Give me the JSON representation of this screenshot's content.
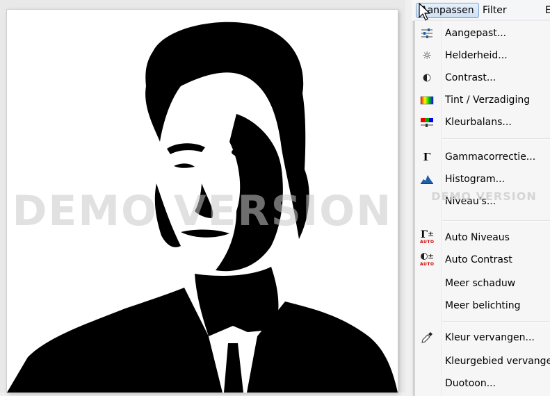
{
  "canvas": {
    "watermark": "DEMO VERSION"
  },
  "menubar": {
    "items": [
      "Aanpassen",
      "Filter",
      "E"
    ]
  },
  "menu": {
    "watermark": "DEMO VERSION",
    "items": [
      {
        "label": "Aangepast...",
        "icon": "sliders-icon"
      },
      {
        "label": "Helderheid...",
        "icon": "sun-icon"
      },
      {
        "label": "Contrast...",
        "icon": "contrast-icon"
      },
      {
        "label": "Tint / Verzadiging",
        "icon": "hue-saturation-icon"
      },
      {
        "label": "Kleurbalans...",
        "icon": "color-balance-icon"
      },
      {
        "label": "Gammacorrectie...",
        "icon": "gamma-icon"
      },
      {
        "label": "Histogram...",
        "icon": "histogram-icon"
      },
      {
        "label": "Niveau's...",
        "icon": ""
      },
      {
        "label": "Auto Niveaus",
        "icon": "auto-levels-icon"
      },
      {
        "label": "Auto Contrast",
        "icon": "auto-contrast-icon"
      },
      {
        "label": "Meer schaduw",
        "icon": ""
      },
      {
        "label": "Meer belichting",
        "icon": ""
      },
      {
        "label": "Kleur vervangen...",
        "icon": "eyedropper-icon"
      },
      {
        "label": "Kleurgebied vervangen...",
        "icon": ""
      },
      {
        "label": "Duotoon...",
        "icon": ""
      }
    ],
    "icon_glyphs": {
      "gamma": "Γ",
      "auto_badge": "AUTO",
      "plusminus": "±"
    }
  }
}
